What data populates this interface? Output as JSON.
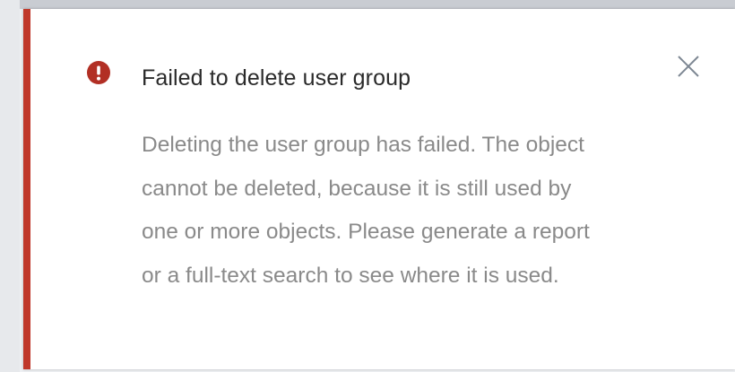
{
  "toast": {
    "type": "error",
    "title": "Failed to delete user group",
    "message_lines": [
      "Deleting the user group has failed. The object",
      "cannot be deleted, because it is still used by",
      "one or more objects. Please generate a report",
      "or a full-text search to see where it is used."
    ],
    "icons": {
      "status": "exclamation-circle-icon",
      "close": "close-icon"
    },
    "colors": {
      "accent": "#c0392b",
      "icon": "#b22f24",
      "title": "#2a2a2a",
      "message": "#8a8a8a",
      "close": "#7d8793"
    }
  }
}
